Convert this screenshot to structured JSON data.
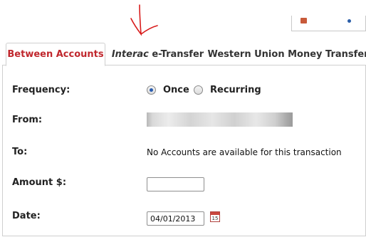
{
  "tabs": [
    {
      "label": "Between Accounts",
      "active": true
    },
    {
      "label_italic": "Interac",
      "label_rest": " e-Transfer",
      "active": false
    },
    {
      "label": "Western Union Money Transfer",
      "active": false
    }
  ],
  "form": {
    "frequency_label": "Frequency:",
    "frequency_options": [
      {
        "label": "Once",
        "selected": true
      },
      {
        "label": "Recurring",
        "selected": false
      }
    ],
    "from_label": "From:",
    "to_label": "To:",
    "to_value": "No Accounts are available for this transaction",
    "amount_label": "Amount $:",
    "amount_value": "",
    "date_label": "Date:",
    "date_value": "04/01/2013",
    "calendar_icon_text": "15"
  },
  "colors": {
    "active_tab": "#c0272d",
    "annotation": "#d81b1b",
    "radio_dot": "#2a5db0"
  }
}
